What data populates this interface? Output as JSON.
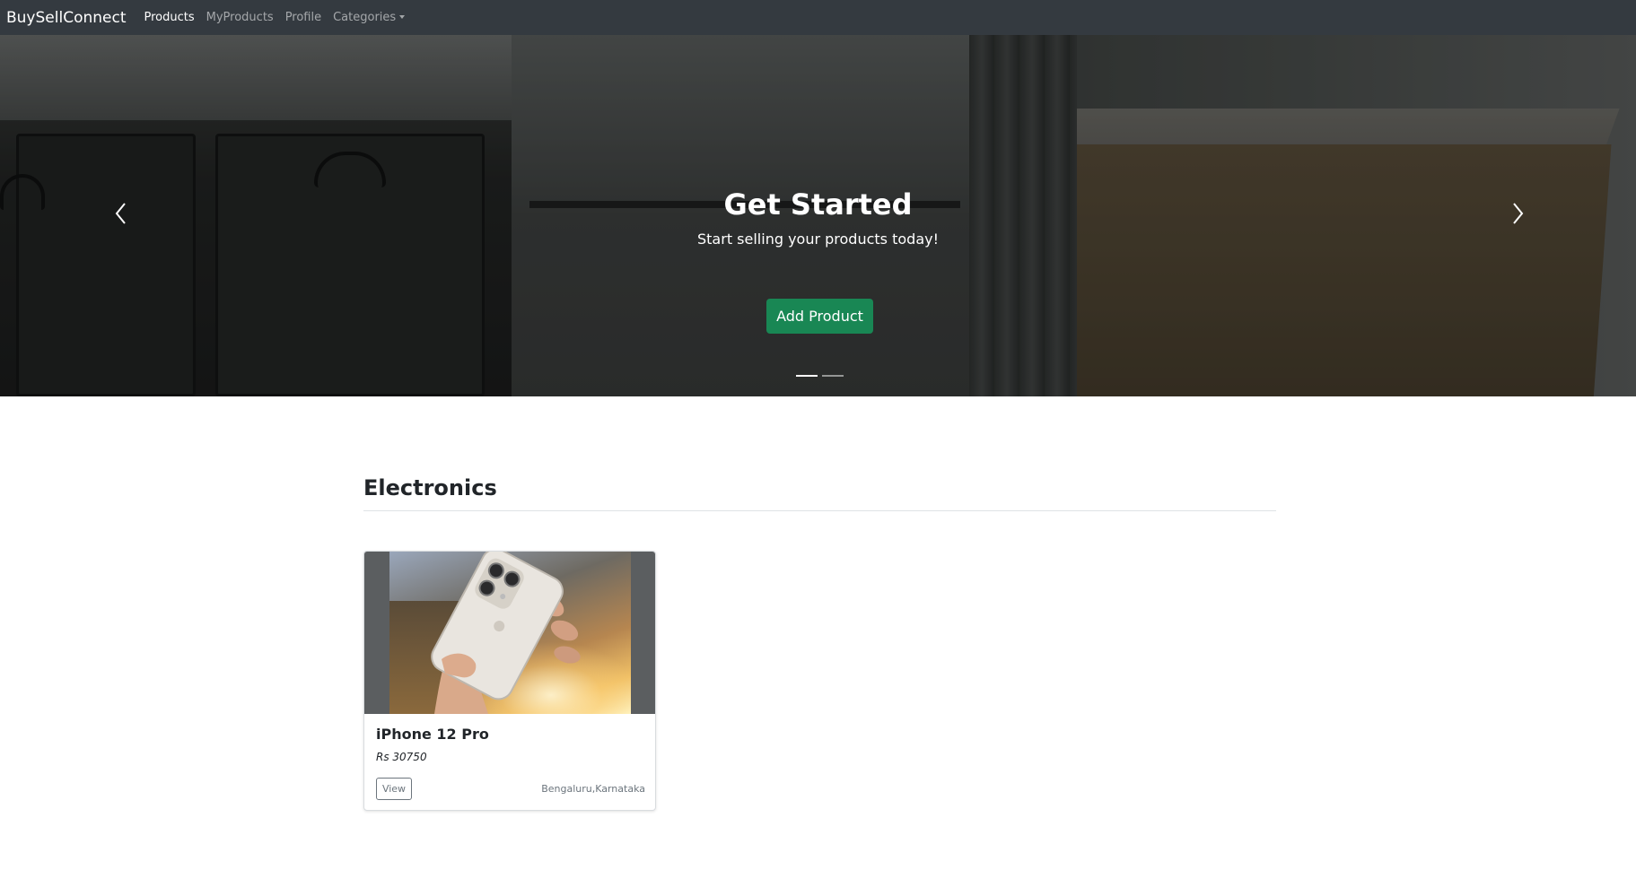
{
  "navbar": {
    "brand": "BuySellConnect",
    "links": [
      {
        "label": "Products",
        "active": true
      },
      {
        "label": "MyProducts",
        "active": false
      },
      {
        "label": "Profile",
        "active": false
      },
      {
        "label": "Categories",
        "active": false,
        "dropdown": true
      }
    ],
    "background_color": "#343a40"
  },
  "hero": {
    "title": "Get Started",
    "subtitle": "Start selling your products today!",
    "button_label": "Add Product",
    "button_color": "#198754",
    "prev_icon": "chevron-left-icon",
    "next_icon": "chevron-right-icon",
    "slides_count": 2,
    "active_slide": 1
  },
  "section": {
    "title": "Electronics"
  },
  "products": [
    {
      "name": "iPhone 12 Pro",
      "price": "Rs 30750",
      "view_label": "View",
      "location": "Bengaluru,Karnataka"
    }
  ]
}
